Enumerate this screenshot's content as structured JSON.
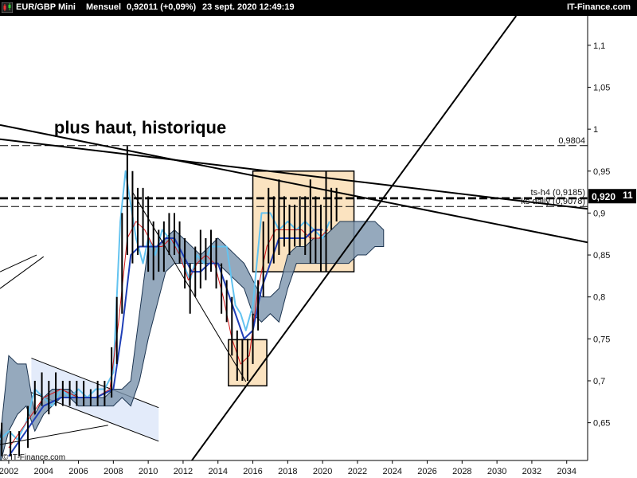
{
  "header": {
    "instrument": "EUR/GBP Mini",
    "period": "Mensuel",
    "quote": "0,92011 (+0,09%)",
    "datetime": "23 sept. 2020 12:49:19",
    "brand": "IT-Finance.com",
    "logo_icon": "candlestick-chart-icon"
  },
  "watermark": "© IT-Finance.com",
  "chart_data": {
    "type": "candlestick",
    "title": "",
    "xlabel": "",
    "ylabel": "",
    "xlim": [
      2001.5,
      2035.2
    ],
    "ylim": [
      0.605,
      1.135
    ],
    "x_ticks": [
      {
        "value": 2002,
        "label": "2002"
      },
      {
        "value": 2004,
        "label": "2004"
      },
      {
        "value": 2006,
        "label": "2006"
      },
      {
        "value": 2008,
        "label": "2008"
      },
      {
        "value": 2010,
        "label": "2010"
      },
      {
        "value": 2012,
        "label": "2012"
      },
      {
        "value": 2014,
        "label": "2014"
      },
      {
        "value": 2016,
        "label": "2016"
      },
      {
        "value": 2018,
        "label": "2018"
      },
      {
        "value": 2020,
        "label": "2020"
      },
      {
        "value": 2022,
        "label": "2022"
      },
      {
        "value": 2024,
        "label": "2024"
      },
      {
        "value": 2026,
        "label": "2026"
      },
      {
        "value": 2028,
        "label": "2028"
      },
      {
        "value": 2030,
        "label": "2030"
      },
      {
        "value": 2032,
        "label": "2032"
      },
      {
        "value": 2034,
        "label": "2034"
      }
    ],
    "y_ticks": [
      {
        "value": 1.1,
        "label": "1,1"
      },
      {
        "value": 1.05,
        "label": "1,05"
      },
      {
        "value": 1.0,
        "label": "1"
      },
      {
        "value": 0.95,
        "label": "0,95"
      },
      {
        "value": 0.9,
        "label": "0,9"
      },
      {
        "value": 0.85,
        "label": "0,85"
      },
      {
        "value": 0.8,
        "label": "0,8"
      },
      {
        "value": 0.75,
        "label": "0,75"
      },
      {
        "value": 0.7,
        "label": "0,7"
      },
      {
        "value": 0.65,
        "label": "0,65"
      }
    ],
    "grid": false,
    "current_price": {
      "value": 0.92011,
      "label": "0,920",
      "label_suffix": "11"
    },
    "horizontal_levels": [
      {
        "value": 0.9804,
        "label": "0,9804",
        "style": "dashed"
      },
      {
        "value": 0.9185,
        "label": "ts-h4 (0,9185)",
        "style": "dashed"
      },
      {
        "value": 0.9175,
        "label": "",
        "style": "dashed"
      },
      {
        "value": 0.9168,
        "label": "",
        "style": "dashed"
      },
      {
        "value": 0.9078,
        "label": "ks daily (0,9078)",
        "style": "dashed"
      }
    ],
    "annotations": [
      {
        "text": "plus haut, historique",
        "x": 2004.6,
        "y": 0.995
      }
    ],
    "trendlines": [
      {
        "name": "",
        "points": [
          [
            2001.5,
            1.005
          ],
          [
            2035.2,
            0.865
          ]
        ]
      },
      {
        "name": "",
        "points": [
          [
            2001.5,
            0.988
          ],
          [
            2035.2,
            0.905
          ]
        ]
      },
      {
        "name": "",
        "points": [
          [
            2011.8,
            0.585
          ],
          [
            2031.1,
            1.135
          ]
        ]
      },
      {
        "name": "",
        "points": [
          [
            2001.5,
            0.624
          ],
          [
            2007.7,
            0.647
          ]
        ]
      },
      {
        "name": "",
        "points": [
          [
            2001.5,
            0.81
          ],
          [
            2004.0,
            0.848
          ]
        ]
      },
      {
        "name": "",
        "points": [
          [
            2001.5,
            0.83
          ],
          [
            2003.6,
            0.85
          ]
        ]
      },
      {
        "name": "",
        "points": [
          [
            2009.1,
            0.925
          ],
          [
            2015.6,
            0.699
          ]
        ]
      }
    ],
    "channel": {
      "upper": [
        [
          2003.3,
          0.727
        ],
        [
          2010.6,
          0.668
        ]
      ],
      "lower": [
        [
          2003.3,
          0.686
        ],
        [
          2010.6,
          0.628
        ]
      ],
      "fill": "#e3ebfa"
    },
    "boxes": [
      {
        "x0": 2016.0,
        "x1": 2021.8,
        "y0": 0.83,
        "y1": 0.95,
        "fill": "#fbe3c0"
      },
      {
        "x0": 2014.6,
        "x1": 2016.8,
        "y0": 0.694,
        "y1": 0.749,
        "fill": "#fbe3c0"
      }
    ],
    "series": [
      {
        "name": "",
        "color": "#63c3f0",
        "values": [
          [
            2001.5,
            0.63
          ],
          [
            2002.0,
            0.64
          ],
          [
            2002.5,
            0.63
          ],
          [
            2003.0,
            0.65
          ],
          [
            2003.5,
            0.69
          ],
          [
            2004.0,
            0.68
          ],
          [
            2004.5,
            0.67
          ],
          [
            2005.0,
            0.69
          ],
          [
            2005.5,
            0.68
          ],
          [
            2006.0,
            0.69
          ],
          [
            2006.5,
            0.68
          ],
          [
            2007.0,
            0.69
          ],
          [
            2007.5,
            0.69
          ],
          [
            2008.0,
            0.71
          ],
          [
            2008.4,
            0.89
          ],
          [
            2008.7,
            0.95
          ],
          [
            2009.0,
            0.91
          ],
          [
            2009.3,
            0.87
          ],
          [
            2009.7,
            0.84
          ],
          [
            2010.0,
            0.87
          ],
          [
            2010.4,
            0.85
          ],
          [
            2010.8,
            0.88
          ],
          [
            2011.2,
            0.87
          ],
          [
            2011.6,
            0.86
          ],
          [
            2012.0,
            0.84
          ],
          [
            2012.4,
            0.82
          ],
          [
            2012.8,
            0.85
          ],
          [
            2013.2,
            0.84
          ],
          [
            2013.6,
            0.86
          ],
          [
            2014.0,
            0.86
          ],
          [
            2014.5,
            0.86
          ],
          [
            2015.0,
            0.79
          ],
          [
            2015.3,
            0.78
          ],
          [
            2015.6,
            0.76
          ],
          [
            2016.0,
            0.79
          ],
          [
            2016.5,
            0.9
          ],
          [
            2017.0,
            0.9
          ],
          [
            2017.5,
            0.88
          ],
          [
            2018.0,
            0.89
          ],
          [
            2018.5,
            0.88
          ],
          [
            2019.0,
            0.89
          ],
          [
            2019.5,
            0.88
          ],
          [
            2020.0,
            0.87
          ],
          [
            2020.4,
            0.89
          ]
        ]
      },
      {
        "name": "",
        "color": "#d8171a",
        "values": [
          [
            2002.0,
            0.62
          ],
          [
            2003.0,
            0.65
          ],
          [
            2004.0,
            0.68
          ],
          [
            2005.0,
            0.69
          ],
          [
            2006.0,
            0.68
          ],
          [
            2007.0,
            0.68
          ],
          [
            2007.8,
            0.69
          ],
          [
            2008.3,
            0.77
          ],
          [
            2008.8,
            0.87
          ],
          [
            2009.3,
            0.89
          ],
          [
            2009.8,
            0.88
          ],
          [
            2010.3,
            0.86
          ],
          [
            2010.8,
            0.86
          ],
          [
            2011.3,
            0.87
          ],
          [
            2011.8,
            0.85
          ],
          [
            2012.3,
            0.82
          ],
          [
            2012.8,
            0.84
          ],
          [
            2013.3,
            0.85
          ],
          [
            2013.8,
            0.84
          ],
          [
            2014.3,
            0.8
          ],
          [
            2014.8,
            0.75
          ],
          [
            2015.3,
            0.72
          ],
          [
            2015.8,
            0.73
          ],
          [
            2016.3,
            0.81
          ],
          [
            2016.8,
            0.86
          ],
          [
            2017.3,
            0.88
          ],
          [
            2017.8,
            0.88
          ],
          [
            2018.3,
            0.88
          ],
          [
            2018.8,
            0.88
          ],
          [
            2019.3,
            0.87
          ],
          [
            2019.8,
            0.87
          ],
          [
            2020.3,
            0.88
          ]
        ]
      },
      {
        "name": "",
        "color": "#1f3fb7",
        "values": [
          [
            2002.0,
            0.61
          ],
          [
            2003.0,
            0.64
          ],
          [
            2004.0,
            0.67
          ],
          [
            2005.0,
            0.68
          ],
          [
            2006.0,
            0.68
          ],
          [
            2007.0,
            0.68
          ],
          [
            2008.0,
            0.69
          ],
          [
            2008.5,
            0.76
          ],
          [
            2009.0,
            0.85
          ],
          [
            2009.5,
            0.86
          ],
          [
            2010.0,
            0.86
          ],
          [
            2010.5,
            0.86
          ],
          [
            2011.0,
            0.87
          ],
          [
            2011.5,
            0.87
          ],
          [
            2012.0,
            0.85
          ],
          [
            2012.5,
            0.83
          ],
          [
            2013.0,
            0.83
          ],
          [
            2013.5,
            0.84
          ],
          [
            2014.0,
            0.84
          ],
          [
            2014.5,
            0.81
          ],
          [
            2015.0,
            0.78
          ],
          [
            2015.5,
            0.75
          ],
          [
            2016.0,
            0.76
          ],
          [
            2016.5,
            0.81
          ],
          [
            2017.0,
            0.84
          ],
          [
            2017.5,
            0.87
          ],
          [
            2018.0,
            0.87
          ],
          [
            2018.5,
            0.87
          ],
          [
            2019.0,
            0.87
          ],
          [
            2019.5,
            0.88
          ],
          [
            2020.0,
            0.88
          ]
        ]
      }
    ],
    "cloud": [
      {
        "x": 2001.5,
        "a": 0.63,
        "b": 0.6
      },
      {
        "x": 2002.0,
        "a": 0.73,
        "b": 0.64
      },
      {
        "x": 2002.5,
        "a": 0.72,
        "b": 0.66
      },
      {
        "x": 2003.0,
        "a": 0.72,
        "b": 0.67
      },
      {
        "x": 2003.5,
        "a": 0.66,
        "b": 0.64
      },
      {
        "x": 2004.0,
        "a": 0.68,
        "b": 0.66
      },
      {
        "x": 2004.5,
        "a": 0.69,
        "b": 0.67
      },
      {
        "x": 2005.0,
        "a": 0.69,
        "b": 0.68
      },
      {
        "x": 2005.5,
        "a": 0.69,
        "b": 0.68
      },
      {
        "x": 2006.0,
        "a": 0.68,
        "b": 0.67
      },
      {
        "x": 2006.5,
        "a": 0.68,
        "b": 0.67
      },
      {
        "x": 2007.0,
        "a": 0.68,
        "b": 0.67
      },
      {
        "x": 2007.5,
        "a": 0.68,
        "b": 0.67
      },
      {
        "x": 2008.0,
        "a": 0.69,
        "b": 0.67
      },
      {
        "x": 2008.5,
        "a": 0.69,
        "b": 0.68
      },
      {
        "x": 2009.0,
        "a": 0.7,
        "b": 0.67
      },
      {
        "x": 2009.5,
        "a": 0.78,
        "b": 0.7
      },
      {
        "x": 2010.0,
        "a": 0.86,
        "b": 0.75
      },
      {
        "x": 2010.5,
        "a": 0.86,
        "b": 0.79
      },
      {
        "x": 2011.0,
        "a": 0.87,
        "b": 0.83
      },
      {
        "x": 2011.5,
        "a": 0.88,
        "b": 0.84
      },
      {
        "x": 2012.0,
        "a": 0.87,
        "b": 0.84
      },
      {
        "x": 2012.5,
        "a": 0.86,
        "b": 0.84
      },
      {
        "x": 2013.0,
        "a": 0.85,
        "b": 0.84
      },
      {
        "x": 2013.5,
        "a": 0.86,
        "b": 0.84
      },
      {
        "x": 2014.0,
        "a": 0.87,
        "b": 0.84
      },
      {
        "x": 2014.5,
        "a": 0.86,
        "b": 0.83
      },
      {
        "x": 2015.0,
        "a": 0.85,
        "b": 0.82
      },
      {
        "x": 2015.5,
        "a": 0.84,
        "b": 0.81
      },
      {
        "x": 2016.0,
        "a": 0.82,
        "b": 0.78
      },
      {
        "x": 2016.5,
        "a": 0.8,
        "b": 0.77
      },
      {
        "x": 2017.0,
        "a": 0.8,
        "b": 0.78
      },
      {
        "x": 2017.5,
        "a": 0.81,
        "b": 0.77
      },
      {
        "x": 2018.0,
        "a": 0.85,
        "b": 0.81
      },
      {
        "x": 2018.5,
        "a": 0.86,
        "b": 0.84
      },
      {
        "x": 2019.0,
        "a": 0.86,
        "b": 0.84
      },
      {
        "x": 2019.5,
        "a": 0.87,
        "b": 0.84
      },
      {
        "x": 2020.0,
        "a": 0.87,
        "b": 0.84
      },
      {
        "x": 2020.5,
        "a": 0.88,
        "b": 0.84
      },
      {
        "x": 2021.0,
        "a": 0.89,
        "b": 0.84
      },
      {
        "x": 2021.5,
        "a": 0.89,
        "b": 0.84
      },
      {
        "x": 2022.0,
        "a": 0.89,
        "b": 0.85
      },
      {
        "x": 2022.5,
        "a": 0.89,
        "b": 0.85
      },
      {
        "x": 2023.0,
        "a": 0.89,
        "b": 0.86
      },
      {
        "x": 2023.5,
        "a": 0.88,
        "b": 0.86
      }
    ],
    "candles": [
      {
        "x": 2001.6,
        "h": 0.65,
        "l": 0.61
      },
      {
        "x": 2002.1,
        "h": 0.64,
        "l": 0.61
      },
      {
        "x": 2002.6,
        "h": 0.64,
        "l": 0.61
      },
      {
        "x": 2003.1,
        "h": 0.67,
        "l": 0.62
      },
      {
        "x": 2003.5,
        "h": 0.7,
        "l": 0.66
      },
      {
        "x": 2003.9,
        "h": 0.71,
        "l": 0.67
      },
      {
        "x": 2004.3,
        "h": 0.7,
        "l": 0.66
      },
      {
        "x": 2004.7,
        "h": 0.71,
        "l": 0.67
      },
      {
        "x": 2005.1,
        "h": 0.7,
        "l": 0.67
      },
      {
        "x": 2005.5,
        "h": 0.7,
        "l": 0.67
      },
      {
        "x": 2005.9,
        "h": 0.7,
        "l": 0.67
      },
      {
        "x": 2006.3,
        "h": 0.7,
        "l": 0.67
      },
      {
        "x": 2006.7,
        "h": 0.69,
        "l": 0.67
      },
      {
        "x": 2007.1,
        "h": 0.7,
        "l": 0.67
      },
      {
        "x": 2007.5,
        "h": 0.7,
        "l": 0.67
      },
      {
        "x": 2007.9,
        "h": 0.74,
        "l": 0.68
      },
      {
        "x": 2008.2,
        "h": 0.8,
        "l": 0.72
      },
      {
        "x": 2008.5,
        "h": 0.9,
        "l": 0.78
      },
      {
        "x": 2008.8,
        "h": 0.98,
        "l": 0.85
      },
      {
        "x": 2009.1,
        "h": 0.95,
        "l": 0.84
      },
      {
        "x": 2009.4,
        "h": 0.93,
        "l": 0.85
      },
      {
        "x": 2009.7,
        "h": 0.93,
        "l": 0.86
      },
      {
        "x": 2010.0,
        "h": 0.92,
        "l": 0.83
      },
      {
        "x": 2010.3,
        "h": 0.89,
        "l": 0.82
      },
      {
        "x": 2010.6,
        "h": 0.88,
        "l": 0.83
      },
      {
        "x": 2010.9,
        "h": 0.89,
        "l": 0.83
      },
      {
        "x": 2011.2,
        "h": 0.9,
        "l": 0.85
      },
      {
        "x": 2011.5,
        "h": 0.9,
        "l": 0.85
      },
      {
        "x": 2011.8,
        "h": 0.89,
        "l": 0.84
      },
      {
        "x": 2012.1,
        "h": 0.87,
        "l": 0.81
      },
      {
        "x": 2012.4,
        "h": 0.84,
        "l": 0.78
      },
      {
        "x": 2012.7,
        "h": 0.86,
        "l": 0.8
      },
      {
        "x": 2013.0,
        "h": 0.88,
        "l": 0.81
      },
      {
        "x": 2013.3,
        "h": 0.87,
        "l": 0.82
      },
      {
        "x": 2013.6,
        "h": 0.88,
        "l": 0.83
      },
      {
        "x": 2013.9,
        "h": 0.87,
        "l": 0.81
      },
      {
        "x": 2014.2,
        "h": 0.84,
        "l": 0.78
      },
      {
        "x": 2014.5,
        "h": 0.82,
        "l": 0.77
      },
      {
        "x": 2014.8,
        "h": 0.8,
        "l": 0.73
      },
      {
        "x": 2015.1,
        "h": 0.76,
        "l": 0.7
      },
      {
        "x": 2015.4,
        "h": 0.75,
        "l": 0.7
      },
      {
        "x": 2015.7,
        "h": 0.75,
        "l": 0.7
      },
      {
        "x": 2016.0,
        "h": 0.78,
        "l": 0.72
      },
      {
        "x": 2016.3,
        "h": 0.82,
        "l": 0.76
      },
      {
        "x": 2016.6,
        "h": 0.89,
        "l": 0.8
      },
      {
        "x": 2016.9,
        "h": 0.93,
        "l": 0.84
      },
      {
        "x": 2017.2,
        "h": 0.92,
        "l": 0.84
      },
      {
        "x": 2017.5,
        "h": 0.94,
        "l": 0.85
      },
      {
        "x": 2017.8,
        "h": 0.92,
        "l": 0.86
      },
      {
        "x": 2018.1,
        "h": 0.91,
        "l": 0.85
      },
      {
        "x": 2018.4,
        "h": 0.91,
        "l": 0.86
      },
      {
        "x": 2018.7,
        "h": 0.92,
        "l": 0.86
      },
      {
        "x": 2019.0,
        "h": 0.92,
        "l": 0.85
      },
      {
        "x": 2019.3,
        "h": 0.94,
        "l": 0.84
      },
      {
        "x": 2019.6,
        "h": 0.92,
        "l": 0.84
      },
      {
        "x": 2019.9,
        "h": 0.91,
        "l": 0.83
      },
      {
        "x": 2020.2,
        "h": 0.95,
        "l": 0.83
      },
      {
        "x": 2020.5,
        "h": 0.93,
        "l": 0.88
      },
      {
        "x": 2020.8,
        "h": 0.93,
        "l": 0.89
      }
    ]
  },
  "colors": {
    "background": "#ffffff",
    "header_bg": "#000000",
    "header_text": "#ffffff",
    "axis": "#000000",
    "cloud_fill": "#7b93ad",
    "cloud_stroke": "#1c3450",
    "box_stroke": "#000000",
    "price_tag_bg": "#000000",
    "candle": "#000000"
  }
}
